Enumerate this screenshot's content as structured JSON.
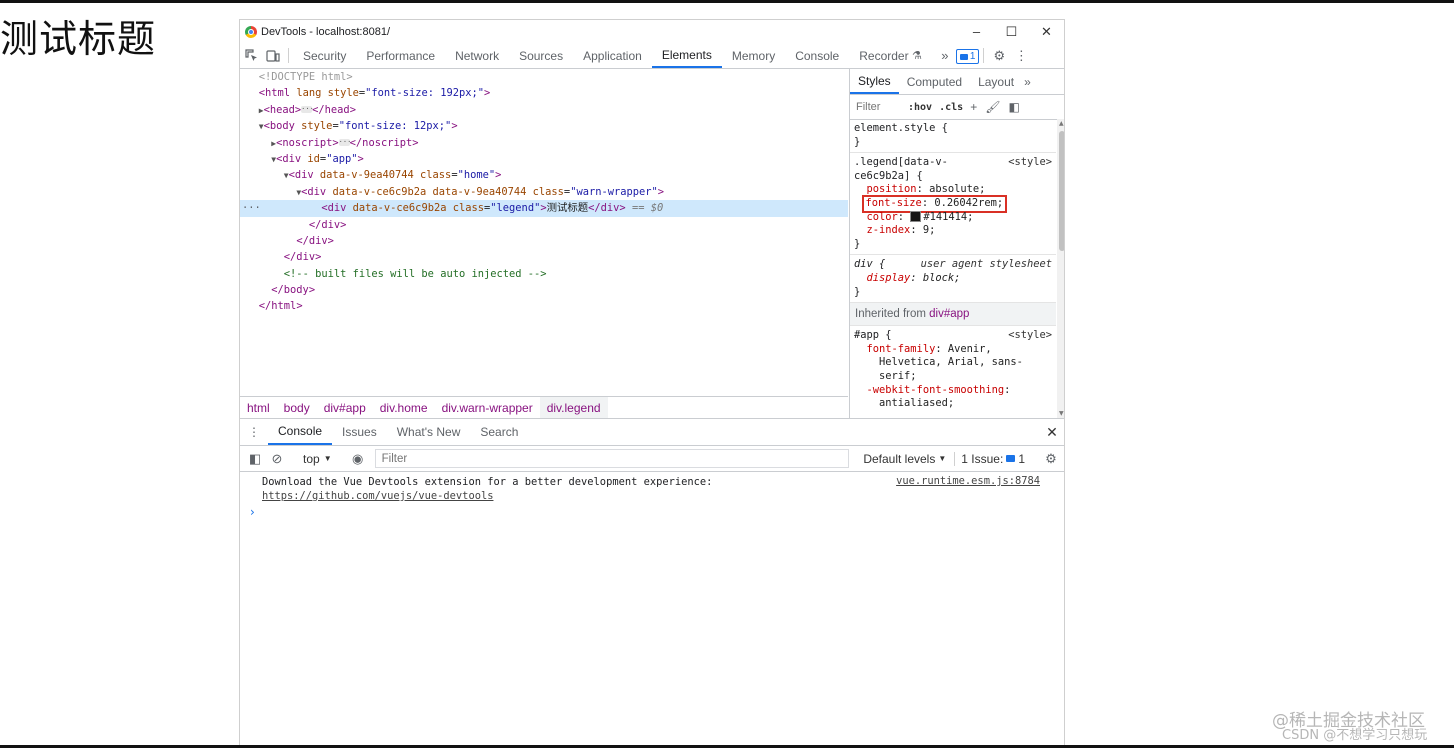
{
  "page": {
    "title": "测试标题",
    "watermark_line1": "@稀土掘金技术社区",
    "watermark_line2": "CSDN @不想学习只想玩"
  },
  "window": {
    "title": "DevTools - localhost:8081/",
    "controls": [
      "–",
      "☐",
      "✕"
    ]
  },
  "main_tabs": [
    "Security",
    "Performance",
    "Network",
    "Sources",
    "Application",
    "Elements",
    "Memory",
    "Console",
    "Recorder"
  ],
  "main_active_tab": "Elements",
  "main_badge": "1",
  "elements_tree": {
    "l1": "<!DOCTYPE html>",
    "l2_tag": "<html",
    "l2_attr": "lang style",
    "l2_val": "\"font-size: 192px;\"",
    "l3_head": "<head>",
    "l3_close": "</head>",
    "l4_tag": "<body",
    "l4_attr": "style",
    "l4_val": "\"font-size: 12px;\"",
    "l5_open": "<noscript>",
    "l5_close": "</noscript>",
    "l6_tag": "<div",
    "l6_attr": "id",
    "l6_val": "\"app\"",
    "l7_tag": "<div",
    "l7_attr1": "data-v-9ea40744",
    "l7_attr2": "class",
    "l7_val": "\"home\"",
    "l8_tag": "<div",
    "l8_attr1": "data-v-ce6c9b2a data-v-9ea40744",
    "l8_attr2": "class",
    "l8_val": "\"warn-wrapper\"",
    "l9_tag": "<div",
    "l9_attr1": "data-v-ce6c9b2a",
    "l9_attr2": "class",
    "l9_val": "\"legend\"",
    "l9_text": "测试标题",
    "l9_close": "</div>",
    "l9_eq": "== $0",
    "l10": "</div>",
    "l11": "</div>",
    "l12": "</div>",
    "l13": "<!-- built files will be auto injected -->",
    "l14": "</body>",
    "l15": "</html>"
  },
  "breadcrumbs": [
    "html",
    "body",
    "div#app",
    "div.home",
    "div.warn-wrapper",
    "div.legend"
  ],
  "styles": {
    "tabs": [
      "Styles",
      "Computed",
      "Layout"
    ],
    "filter_placeholder": "Filter",
    "hov": ":hov",
    "cls": ".cls",
    "element_style": "element.style {",
    "close_brace": "}",
    "legend_sel1": ".legend[data-v-",
    "legend_sel2": "ce6c9b2a] {",
    "legend_src": "<style>",
    "position_prop": "position",
    "position_val": "absolute;",
    "fontsize_prop": "font-size",
    "fontsize_val": "0.26042rem;",
    "color_prop": "color",
    "color_val": "#141414;",
    "color_hex": "#141414",
    "zindex_prop": "z-index",
    "zindex_val": "9;",
    "div_sel": "div {",
    "ua_label": "user agent stylesheet",
    "display_prop": "display",
    "display_val": "block;",
    "inherited_from": "Inherited from ",
    "inherited_el": "div#app",
    "app_sel": "#app {",
    "app_src": "<style>",
    "ff_prop": "font-family",
    "ff_val1": "Avenir,",
    "ff_val2": "Helvetica, Arial, sans-",
    "ff_val3": "serif;",
    "wfs_prop": "-webkit-font-smoothing",
    "wfs_val": "antialiased;"
  },
  "drawer": {
    "tabs": [
      "Console",
      "Issues",
      "What's New",
      "Search"
    ],
    "active_tab": "Console",
    "context": "top",
    "filter_placeholder": "Filter",
    "levels": "Default levels",
    "issues_label": "1 Issue:",
    "issues_count": "1",
    "message_line1": "Download the Vue Devtools extension for a better development experience:",
    "message_line2": "https://github.com/vuejs/vue-devtools",
    "message_source": "vue.runtime.esm.js:8784",
    "prompt": "›"
  }
}
